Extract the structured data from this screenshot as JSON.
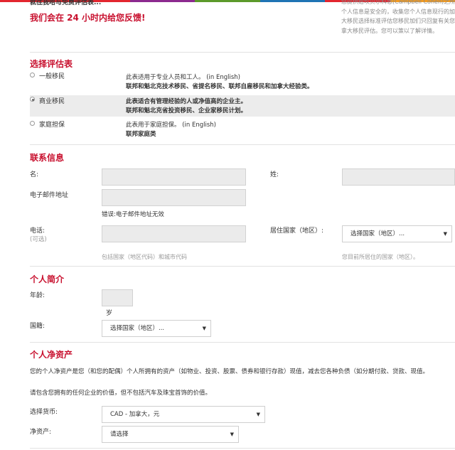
{
  "colors": {
    "accent": "#c8102e",
    "topbar": [
      "#e3262f",
      "#8c2a8f",
      "#5c9a2b",
      "#1f74b4",
      "#e3262f",
      "#f39a1e"
    ]
  },
  "header": {
    "cut_title": "就往我哈与免费评估表...",
    "hero": "我们会在 24 小时内给您反馈!",
    "side_text": "您提供给坎贝尔科恩(Campbell Cohen)之所的个人信息是安全的，收集您个人信息现行的加拿大移民选择标准评估您移民加们只回复有关您加拿大移民评估。您可以策以了解详情。"
  },
  "select_form": {
    "title": "选择评估表",
    "options": [
      {
        "label": "一般移民",
        "desc1": "此表适用于专业人员和工人。 (in English)",
        "desc2": "联邦和魁北克技术移民、省提名移民、联邦自雇移民和加拿大经验类。",
        "checked": false
      },
      {
        "label": "商业移民",
        "desc1": "此表适合有管理经验的人或净值高的企业主。",
        "desc2": "联邦和魁北克省投资移民、企业家移民计划。",
        "checked": true
      },
      {
        "label": "家庭担保",
        "desc1": "此表用于家庭担保。 (in English)",
        "desc2": "联邦家庭类",
        "checked": false
      }
    ]
  },
  "contact": {
    "title": "联系信息",
    "first_name": "名:",
    "last_name": "姓:",
    "email": "电子邮件地址",
    "email_error": "错误:电子邮件地址无效",
    "phone": "电话:",
    "phone_optional": "(可选)",
    "phone_hint": "包括国家（地区代码）和城市代码",
    "residence": "居住国家（地区）:",
    "residence_select": "选择国家（地区）...",
    "residence_hint": "您目前所居住的国家（地区）。"
  },
  "profile": {
    "title": "个人简介",
    "age": "年龄:",
    "age_unit": "岁",
    "nationality": "国籍:",
    "nationality_select": "选择国家（地区）..."
  },
  "networth": {
    "title": "个人净资产",
    "para1": "您的个人净资产是您（和您的配偶）个人所拥有的资产（如物业、投资、股票、债券和银行存款）现值，减去您各种负债（如分期付款、贷款、现值。",
    "para2": "请包含您拥有的任何企业的价值，但不包括汽车及珠宝首饰的价值。",
    "currency_label": "选择货币:",
    "currency_value": "CAD - 加拿大，元",
    "networth_label": "净资产:",
    "networth_value": "请选择"
  }
}
